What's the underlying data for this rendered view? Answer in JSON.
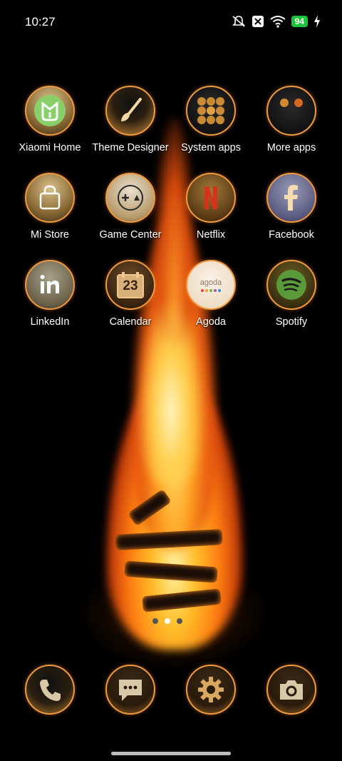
{
  "status_bar": {
    "time": "10:27",
    "battery_percent": "94",
    "icons": [
      "mute-icon",
      "x-notification-icon",
      "wifi-icon",
      "battery-icon",
      "charging-icon"
    ]
  },
  "apps": [
    {
      "label": "Xiaomi Home",
      "icon": "xiaomi-home-icon"
    },
    {
      "label": "Theme Designer",
      "icon": "paintbrush-icon"
    },
    {
      "label": "System apps",
      "icon": "folder-grid-icon"
    },
    {
      "label": "More apps",
      "icon": "folder-icon"
    },
    {
      "label": "Mi Store",
      "icon": "shopping-bag-icon"
    },
    {
      "label": "Game Center",
      "icon": "gamepad-icon"
    },
    {
      "label": "Netflix",
      "icon": "netflix-icon"
    },
    {
      "label": "Facebook",
      "icon": "facebook-icon"
    },
    {
      "label": "LinkedIn",
      "icon": "linkedin-icon"
    },
    {
      "label": "Calendar",
      "icon": "calendar-icon",
      "day": "23"
    },
    {
      "label": "Agoda",
      "icon": "agoda-icon",
      "logo_text": "agoda"
    },
    {
      "label": "Spotify",
      "icon": "spotify-icon"
    }
  ],
  "page_indicator": {
    "pages": 3,
    "active": 2
  },
  "dock": [
    {
      "icon": "phone-icon"
    },
    {
      "icon": "messages-icon"
    },
    {
      "icon": "settings-icon"
    },
    {
      "icon": "camera-icon"
    }
  ],
  "colors": {
    "accent_ring": "#f09a40",
    "battery": "#1fc33a"
  }
}
